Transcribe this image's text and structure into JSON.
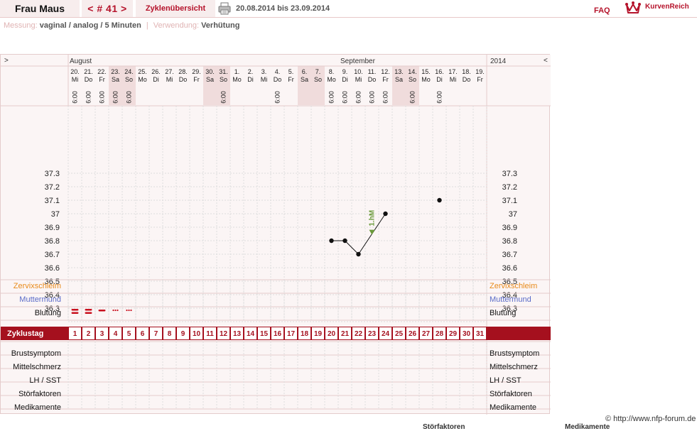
{
  "header": {
    "user_name": "Frau Maus",
    "cycle_nav": "< # 41 >",
    "cycles_overview": "Zyklenübersicht",
    "print_icon": "printer-icon",
    "date_range": "20.08.2014 bis 23.09.2014",
    "faq": "FAQ",
    "logo_icon": "crown-icon",
    "logo_text": "KurvenReich"
  },
  "measurement": {
    "label": "Messung:",
    "value": "vaginal / analog / 5 Minuten",
    "separator": "|",
    "usage_label": "Verwendung:",
    "usage_value": "Verhütung"
  },
  "chart_data": {
    "type": "line",
    "nav_left": ">",
    "nav_right": "<",
    "year": "2014",
    "months": [
      {
        "label": "August",
        "start_index": 0
      },
      {
        "label": "September",
        "start_index": 12
      }
    ],
    "days": [
      {
        "date": "20.",
        "wd": "Mi",
        "time": "6:00",
        "weekend": false
      },
      {
        "date": "21.",
        "wd": "Do",
        "time": "6:00",
        "weekend": false
      },
      {
        "date": "22.",
        "wd": "Fr",
        "time": "6:00",
        "weekend": false
      },
      {
        "date": "23.",
        "wd": "Sa",
        "time": "6:00",
        "weekend": true
      },
      {
        "date": "24.",
        "wd": "So",
        "time": "6:00",
        "weekend": true
      },
      {
        "date": "25.",
        "wd": "Mo",
        "time": "",
        "weekend": false
      },
      {
        "date": "26.",
        "wd": "Di",
        "time": "",
        "weekend": false
      },
      {
        "date": "27.",
        "wd": "Mi",
        "time": "",
        "weekend": false
      },
      {
        "date": "28.",
        "wd": "Do",
        "time": "",
        "weekend": false
      },
      {
        "date": "29.",
        "wd": "Fr",
        "time": "",
        "weekend": false
      },
      {
        "date": "30.",
        "wd": "Sa",
        "time": "",
        "weekend": true
      },
      {
        "date": "31.",
        "wd": "So",
        "time": "6:00",
        "weekend": true
      },
      {
        "date": "1.",
        "wd": "Mo",
        "time": "",
        "weekend": false
      },
      {
        "date": "2.",
        "wd": "Di",
        "time": "",
        "weekend": false
      },
      {
        "date": "3.",
        "wd": "Mi",
        "time": "",
        "weekend": false
      },
      {
        "date": "4.",
        "wd": "Do",
        "time": "6:00",
        "weekend": false
      },
      {
        "date": "5.",
        "wd": "Fr",
        "time": "",
        "weekend": false
      },
      {
        "date": "6.",
        "wd": "Sa",
        "time": "",
        "weekend": true
      },
      {
        "date": "7.",
        "wd": "So",
        "time": "",
        "weekend": true
      },
      {
        "date": "8.",
        "wd": "Mo",
        "time": "6:00",
        "weekend": false
      },
      {
        "date": "9.",
        "wd": "Di",
        "time": "6:00",
        "weekend": false
      },
      {
        "date": "10.",
        "wd": "Mi",
        "time": "6:00",
        "weekend": false
      },
      {
        "date": "11.",
        "wd": "Do",
        "time": "6:00",
        "weekend": false
      },
      {
        "date": "12.",
        "wd": "Fr",
        "time": "6:00",
        "weekend": false
      },
      {
        "date": "13.",
        "wd": "Sa",
        "time": "",
        "weekend": true
      },
      {
        "date": "14.",
        "wd": "So",
        "time": "6:00",
        "weekend": true
      },
      {
        "date": "15.",
        "wd": "Mo",
        "time": "",
        "weekend": false
      },
      {
        "date": "16.",
        "wd": "Di",
        "time": "6:00",
        "weekend": false
      },
      {
        "date": "17.",
        "wd": "Mi",
        "time": "",
        "weekend": false
      },
      {
        "date": "18.",
        "wd": "Do",
        "time": "",
        "weekend": false
      },
      {
        "date": "19.",
        "wd": "Fr",
        "time": "",
        "weekend": false
      }
    ],
    "y_ticks": [
      "37.3",
      "37.2",
      "37.1",
      "37",
      "36.9",
      "36.8",
      "36.7",
      "36.6",
      "36.5",
      "36.4",
      "36.3"
    ],
    "ylim": [
      36.2,
      37.3
    ],
    "series": [
      {
        "points": [
          [
            20,
            36.8
          ],
          [
            21,
            36.8
          ],
          [
            22,
            36.7
          ],
          [
            24,
            37.0
          ]
        ],
        "connected": true
      },
      {
        "points": [
          [
            28,
            37.1
          ]
        ],
        "connected": false
      }
    ],
    "markers": [
      {
        "day": 23,
        "value": 36.86,
        "label": "1.hM",
        "icon": "triangle-down-icon",
        "color": "#6a9a3a"
      }
    ],
    "rows_labels": {
      "zervix": "Zervixschleim",
      "muttermund": "Muttermund",
      "blutung": "Blutung",
      "zyklustag": "Zyklustag",
      "brust": "Brustsymptom",
      "mittel": "Mittelschmerz",
      "lh": "LH / SST",
      "stoer": "Störfaktoren",
      "medi": "Medikamente"
    },
    "bleeding": [
      {
        "day": 1,
        "intensity": "heavy"
      },
      {
        "day": 2,
        "intensity": "heavy"
      },
      {
        "day": 3,
        "intensity": "medium"
      },
      {
        "day": 4,
        "intensity": "spotting"
      },
      {
        "day": 5,
        "intensity": "spotting"
      }
    ],
    "cycle_days": [
      "1",
      "2",
      "3",
      "4",
      "5",
      "6",
      "7",
      "8",
      "9",
      "10",
      "11",
      "12",
      "13",
      "14",
      "15",
      "16",
      "17",
      "18",
      "19",
      "20",
      "21",
      "22",
      "23",
      "24",
      "25",
      "26",
      "27",
      "28",
      "29",
      "30",
      "31"
    ],
    "colors": {
      "zervix": "#e88a1a",
      "muttermund": "#5a6bc8",
      "zyklustag_bg": "#a5101e",
      "weekend_bg": "#f0dcdc",
      "marker": "#6a9a3a"
    }
  },
  "footer": {
    "copyright": "© http://www.nfp-forum.de",
    "cut_text_1": "Störfaktoren",
    "cut_text_2": "Medikamente"
  }
}
